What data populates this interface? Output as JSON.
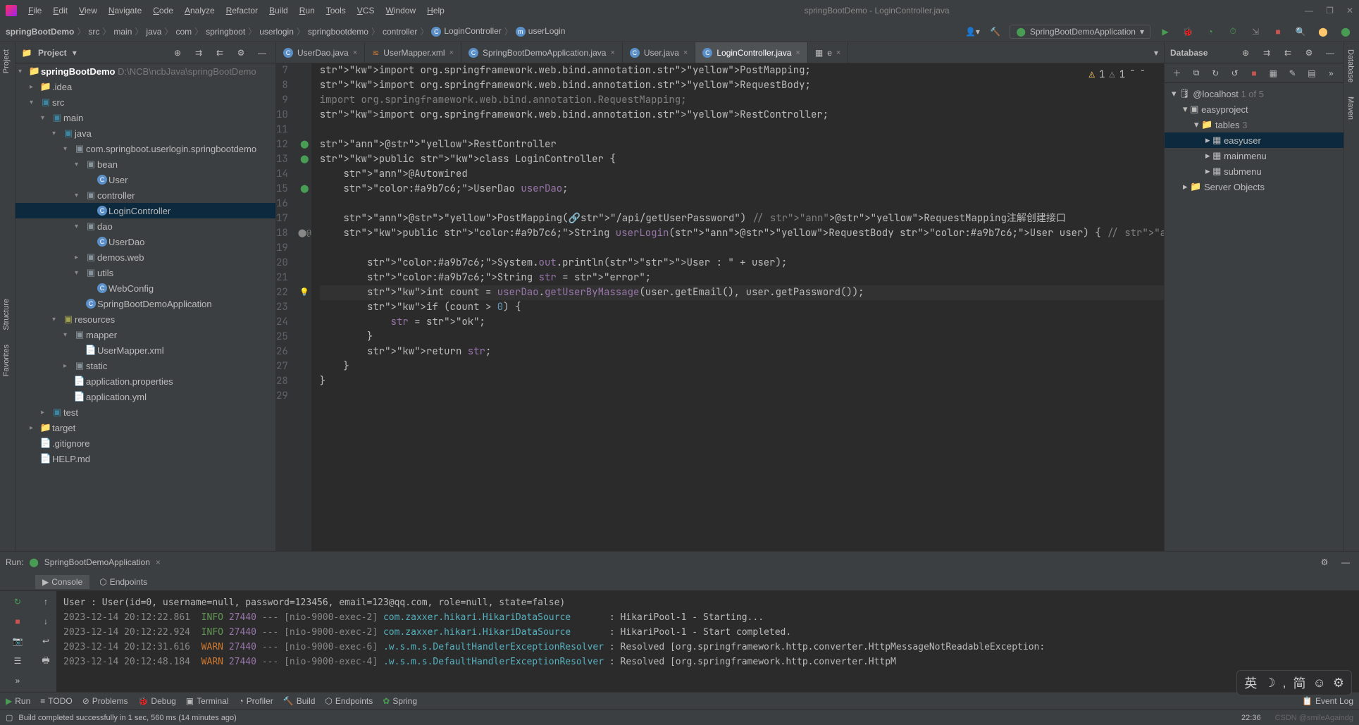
{
  "window_title": "springBootDemo - LoginController.java",
  "menu": [
    "File",
    "Edit",
    "View",
    "Navigate",
    "Code",
    "Analyze",
    "Refactor",
    "Build",
    "Run",
    "Tools",
    "VCS",
    "Window",
    "Help"
  ],
  "breadcrumbs": [
    "springBootDemo",
    "src",
    "main",
    "java",
    "com",
    "springboot",
    "userlogin",
    "springbootdemo",
    "controller",
    "LoginController",
    "userLogin"
  ],
  "run_config": "SpringBootDemoApplication",
  "project_panel_title": "Project",
  "project_root": "springBootDemo",
  "project_root_path": "D:\\NCB\\ncbJava\\springBootDemo",
  "tree": [
    {
      "d": 1,
      "icon": "folder",
      "label": ".idea",
      "arrow": ">"
    },
    {
      "d": 1,
      "icon": "src",
      "label": "src",
      "arrow": "v"
    },
    {
      "d": 2,
      "icon": "src",
      "label": "main",
      "arrow": "v"
    },
    {
      "d": 3,
      "icon": "src",
      "label": "java",
      "arrow": "v"
    },
    {
      "d": 4,
      "icon": "pkg",
      "label": "com.springboot.userlogin.springbootdemo",
      "arrow": "v"
    },
    {
      "d": 5,
      "icon": "pkg",
      "label": "bean",
      "arrow": "v"
    },
    {
      "d": 6,
      "icon": "class",
      "label": "User"
    },
    {
      "d": 5,
      "icon": "pkg",
      "label": "controller",
      "arrow": "v"
    },
    {
      "d": 6,
      "icon": "class",
      "label": "LoginController",
      "sel": true
    },
    {
      "d": 5,
      "icon": "pkg",
      "label": "dao",
      "arrow": "v"
    },
    {
      "d": 6,
      "icon": "class",
      "label": "UserDao"
    },
    {
      "d": 5,
      "icon": "pkg",
      "label": "demos.web",
      "arrow": ">"
    },
    {
      "d": 5,
      "icon": "pkg",
      "label": "utils",
      "arrow": "v"
    },
    {
      "d": 6,
      "icon": "class",
      "label": "WebConfig"
    },
    {
      "d": 5,
      "icon": "class",
      "label": "SpringBootDemoApplication"
    },
    {
      "d": 3,
      "icon": "res",
      "label": "resources",
      "arrow": "v"
    },
    {
      "d": 4,
      "icon": "pkg",
      "label": "mapper",
      "arrow": "v"
    },
    {
      "d": 5,
      "icon": "file",
      "label": "UserMapper.xml"
    },
    {
      "d": 4,
      "icon": "pkg",
      "label": "static",
      "arrow": ">"
    },
    {
      "d": 4,
      "icon": "file",
      "label": "application.properties"
    },
    {
      "d": 4,
      "icon": "file",
      "label": "application.yml"
    },
    {
      "d": 2,
      "icon": "src",
      "label": "test",
      "arrow": ">"
    },
    {
      "d": 1,
      "icon": "folder-ex",
      "label": "target",
      "arrow": ">"
    },
    {
      "d": 1,
      "icon": "file",
      "label": ".gitignore"
    },
    {
      "d": 1,
      "icon": "file",
      "label": "HELP.md"
    }
  ],
  "tabs": [
    {
      "icon": "class",
      "label": "UserDao.java"
    },
    {
      "icon": "xml",
      "label": "UserMapper.xml"
    },
    {
      "icon": "class",
      "label": "SpringBootDemoApplication.java"
    },
    {
      "icon": "class",
      "label": "User.java"
    },
    {
      "icon": "class",
      "label": "LoginController.java",
      "active": true
    },
    {
      "icon": "db",
      "label": "e"
    }
  ],
  "inspect": {
    "warn1": "1",
    "warn2": "1"
  },
  "code_start": 7,
  "code_current": 22,
  "code": [
    {
      "t": "import org.springframework.web.bind.annotation.PostMapping;"
    },
    {
      "t": "import org.springframework.web.bind.annotation.RequestBody;"
    },
    {
      "t": "import org.springframework.web.bind.annotation.RequestMapping;",
      "dim": true
    },
    {
      "t": "import org.springframework.web.bind.annotation.RestController;"
    },
    {
      "t": ""
    },
    {
      "t": "@RestController",
      "gi": "leaf"
    },
    {
      "t": "public class LoginController {",
      "gi": "leaf"
    },
    {
      "t": "    @Autowired"
    },
    {
      "t": "    UserDao userDao;",
      "gi": "leaf"
    },
    {
      "t": ""
    },
    {
      "t": "    @PostMapping(🔗\"/api/getUserPassword\") // @RequestMapping注解创建接口"
    },
    {
      "t": "    public String userLogin(@RequestBody User user) { // @RequestBody注解方便找到user实体",
      "gi": "bean"
    },
    {
      "t": ""
    },
    {
      "t": "        System.out.println(\"User : \" + user);"
    },
    {
      "t": "        String str = \"error\";"
    },
    {
      "t": "        int count = userDao.getUserByMassage(user.getEmail(), user.getPassword());",
      "bulb": true
    },
    {
      "t": "        if (count > 0) {"
    },
    {
      "t": "            str = \"ok\";"
    },
    {
      "t": "        }"
    },
    {
      "t": "        return str;"
    },
    {
      "t": "    }"
    },
    {
      "t": "}"
    },
    {
      "t": ""
    }
  ],
  "db_panel_title": "Database",
  "db_tree": [
    {
      "d": 0,
      "arrow": "v",
      "label": "@localhost",
      "suffix": "1 of 5",
      "icon": "db"
    },
    {
      "d": 1,
      "arrow": "v",
      "label": "easyproject",
      "icon": "schema"
    },
    {
      "d": 2,
      "arrow": "v",
      "label": "tables",
      "suffix": "3",
      "icon": "folder"
    },
    {
      "d": 3,
      "arrow": ">",
      "label": "easyuser",
      "icon": "table",
      "sel": true
    },
    {
      "d": 3,
      "arrow": ">",
      "label": "mainmenu",
      "icon": "table"
    },
    {
      "d": 3,
      "arrow": ">",
      "label": "submenu",
      "icon": "table"
    },
    {
      "d": 1,
      "arrow": ">",
      "label": "Server Objects",
      "icon": "folder"
    }
  ],
  "run_title": "Run:",
  "run_tab": "SpringBootDemoApplication",
  "runtabs": [
    "Console",
    "Endpoints"
  ],
  "console_lines": [
    {
      "pre": "",
      "txt": "User : User(id=0, username=null, password=123456, email=123@qq.com, role=null, state=false)"
    },
    {
      "ts": "2023-12-14 20:12:22.861",
      "lvl": "INFO",
      "pid": "27440",
      "thr": "[nio-9000-exec-2]",
      "cls": "com.zaxxer.hikari.HikariDataSource",
      "msg": "HikariPool-1 - Starting..."
    },
    {
      "ts": "2023-12-14 20:12:22.924",
      "lvl": "INFO",
      "pid": "27440",
      "thr": "[nio-9000-exec-2]",
      "cls": "com.zaxxer.hikari.HikariDataSource",
      "msg": "HikariPool-1 - Start completed."
    },
    {
      "ts": "2023-12-14 20:12:31.616",
      "lvl": "WARN",
      "pid": "27440",
      "thr": "[nio-9000-exec-6]",
      "cls": ".w.s.m.s.DefaultHandlerExceptionResolver",
      "msg": "Resolved [org.springframework.http.converter.HttpMessageNotReadableException:"
    },
    {
      "ts": "2023-12-14 20:12:48.184",
      "lvl": "WARN",
      "pid": "27440",
      "thr": "[nio-9000-exec-4]",
      "cls": ".w.s.m.s.DefaultHandlerExceptionResolver",
      "msg": "Resolved [org.springframework.http.converter.HttpM"
    }
  ],
  "toolstrip": [
    "Run",
    "TODO",
    "Problems",
    "Debug",
    "Terminal",
    "Profiler",
    "Build",
    "Endpoints",
    "Spring"
  ],
  "toolstrip_right": "Event Log",
  "status_msg": "Build completed successfully in 1 sec, 560 ms (14 minutes ago)",
  "status_time": "22:36",
  "status_watermark": "CSDN @smileAgaindg",
  "ime": [
    "英",
    "☽",
    ",",
    "简",
    "☺",
    "⚙"
  ],
  "rails": {
    "left": [
      "Project",
      "Structure",
      "Favorites"
    ],
    "right": [
      "Database",
      "Maven"
    ]
  }
}
